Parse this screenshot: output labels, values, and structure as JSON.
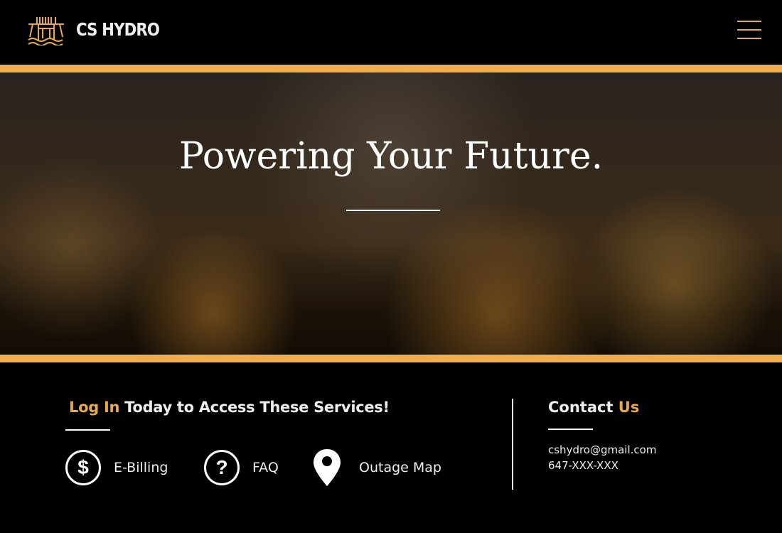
{
  "header": {
    "brand": "CS HYDRO",
    "logo_icon": "dam-logo-icon",
    "menu_icon": "hamburger-icon"
  },
  "hero": {
    "title": "Powering Your Future."
  },
  "services": {
    "heading_accent": "Log In",
    "heading_rest": " Today to Access These Services!",
    "items": [
      {
        "label": "E-Billing",
        "icon": "dollar-icon"
      },
      {
        "label": "FAQ",
        "icon": "question-icon"
      },
      {
        "label": "Outage Map",
        "icon": "map-pin-icon"
      }
    ]
  },
  "contact": {
    "heading_main": "Contact ",
    "heading_accent": "Us",
    "email": "cshydro@gmail.com",
    "phone": "647-XXX-XXX"
  },
  "colors": {
    "accent": "#f0ad4e",
    "background": "#000000"
  }
}
